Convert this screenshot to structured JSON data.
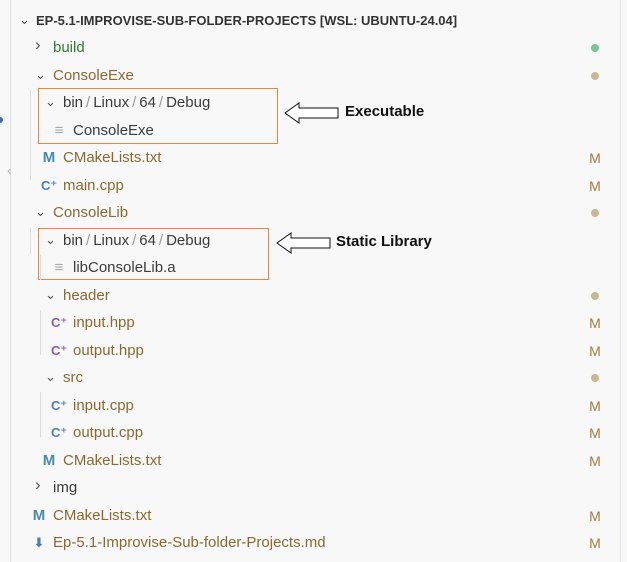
{
  "explorer": {
    "root": {
      "label": "EP-5.1-IMPROVISE-SUB-FOLDER-PROJECTS [WSL: UBUNTU-24.04]"
    },
    "rows": [
      {
        "label": "build",
        "level": 1,
        "kind": "folder",
        "expanded": false,
        "status": "untracked",
        "color": "#2e7d32"
      },
      {
        "label": "ConsoleExe",
        "level": 1,
        "kind": "folder",
        "expanded": true,
        "status": "modified-dot",
        "color": "#8a6a32"
      },
      {
        "label": "bin / Linux / 64 / Debug",
        "segments": [
          "bin",
          "Linux",
          "64",
          "Debug"
        ],
        "level": 2,
        "kind": "folder",
        "expanded": true,
        "color": "#3b3b3b"
      },
      {
        "label": "ConsoleExe",
        "level": 3,
        "kind": "file",
        "icon": "lines-icon",
        "color": "#3b3b3b"
      },
      {
        "label": "CMakeLists.txt",
        "level": 2,
        "kind": "file",
        "icon": "cmake-icon",
        "status": "M",
        "color": "#8a6a32"
      },
      {
        "label": "main.cpp",
        "level": 2,
        "kind": "file",
        "icon": "cpp-icon",
        "status": "M",
        "color": "#8a6a32"
      },
      {
        "label": "ConsoleLib",
        "level": 1,
        "kind": "folder",
        "expanded": true,
        "status": "modified-dot",
        "color": "#8a6a32"
      },
      {
        "label": "bin / Linux / 64 / Debug",
        "segments": [
          "bin",
          "Linux",
          "64",
          "Debug"
        ],
        "level": 2,
        "kind": "folder",
        "expanded": true,
        "color": "#3b3b3b"
      },
      {
        "label": "libConsoleLib.a",
        "level": 3,
        "kind": "file",
        "icon": "lines-icon",
        "color": "#3b3b3b"
      },
      {
        "label": "header",
        "level": 2,
        "kind": "folder",
        "expanded": true,
        "status": "modified-dot",
        "color": "#8a6a32"
      },
      {
        "label": "input.hpp",
        "level": 3,
        "kind": "file",
        "icon": "hpp-icon",
        "status": "M",
        "color": "#8a6a32"
      },
      {
        "label": "output.hpp",
        "level": 3,
        "kind": "file",
        "icon": "hpp-icon",
        "status": "M",
        "color": "#8a6a32"
      },
      {
        "label": "src",
        "level": 2,
        "kind": "folder",
        "expanded": true,
        "status": "modified-dot",
        "color": "#8a6a32"
      },
      {
        "label": "input.cpp",
        "level": 3,
        "kind": "file",
        "icon": "cpp-icon",
        "status": "M",
        "color": "#8a6a32"
      },
      {
        "label": "output.cpp",
        "level": 3,
        "kind": "file",
        "icon": "cpp-icon",
        "status": "M",
        "color": "#8a6a32"
      },
      {
        "label": "CMakeLists.txt",
        "level": 2,
        "kind": "file",
        "icon": "cmake-icon",
        "status": "M",
        "color": "#8a6a32"
      },
      {
        "label": "img",
        "level": 1,
        "kind": "folder",
        "expanded": false,
        "color": "#3b3b3b"
      },
      {
        "label": "CMakeLists.txt",
        "level": 1,
        "kind": "file",
        "icon": "cmake-icon",
        "status": "M",
        "color": "#8a6a32"
      },
      {
        "label": "Ep-5.1-Improvise-Sub-folder-Projects.md",
        "level": 1,
        "kind": "file",
        "icon": "markdown-download-icon",
        "status": "M",
        "color": "#8a6a32"
      }
    ]
  },
  "annotations": {
    "executable": "Executable",
    "static_library": "Static Library"
  },
  "colors": {
    "modified_badge": "#a07c40",
    "modified_dot": "#c9b896",
    "untracked_dot": "#73c991",
    "highlight_box": "#e8883c",
    "cmake_icon": "#4a8ab0",
    "cpp_icon": "#4a7fb0",
    "hpp_icon": "#8a5cb0",
    "md_icon": "#4a7fb0"
  }
}
